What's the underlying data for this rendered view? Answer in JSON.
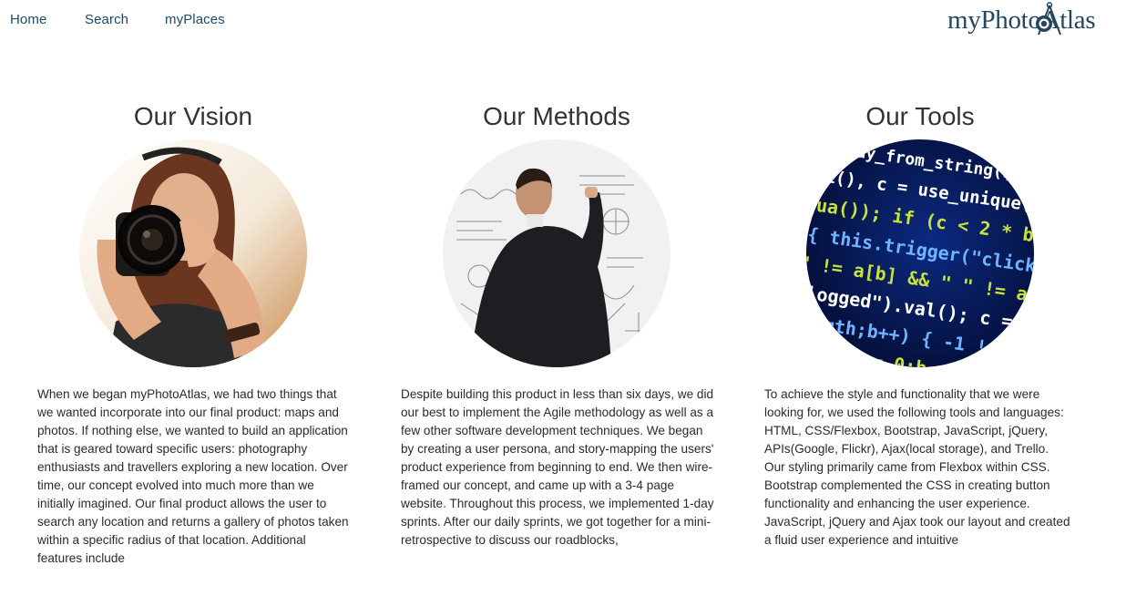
{
  "nav": {
    "home": "Home",
    "search": "Search",
    "myplaces": "myPlaces"
  },
  "logo": {
    "text": "myPhotoAtlas",
    "icon": "camera-compass-icon"
  },
  "colors": {
    "nav_link": "#1c4a68",
    "logo": "#23465f",
    "heading": "#333333",
    "body_text": "#2b2b2b"
  },
  "sections": [
    {
      "title": "Our Vision",
      "image": "photographer-woman-with-camera",
      "text": "When we began myPhotoAtlas, we had two things that we wanted incorporate into our final product: maps and photos. If nothing else, we wanted to build an application that is geared toward specific users: photography enthusiasts and travellers exploring a new location. Over time, our concept evolved into much more than we initially imagined. Our final product allows the user to search any location and returns a gallery of photos taken within a specific radius of that location. Additional features include"
    },
    {
      "title": "Our Methods",
      "image": "man-writing-on-whiteboard",
      "text": "Despite building this product in less than six days, we did our best to implement the Agile methodology as well as a few other software development techniques. We began by creating a user persona, and story-mapping the users' product experience from beginning to end. We then wire-framed our concept, and came up with a 3-4 page website. Throughout this process, we implemented 1-day sprints. After our daily sprints, we got together for a mini-retrospective to discuss our roadblocks,"
    },
    {
      "title": "Our Tools",
      "image": "code-on-screen",
      "text_lines": [
        "To achieve the style and functionality that we were looking for, we used the following tools and languages: HTML, CSS/Flexbox, Bootstrap, JavaScript, jQuery, APIs(Google, Flickr), Ajax(local storage), and Trello.",
        "Our styling primarily came from Flexbox within CSS. Bootstrap complemented the CSS in creating button functionality and enhancing the user experience. JavaScript, jQuery and Ajax took our layout and created a fluid user experience and intuitive"
      ]
    }
  ]
}
